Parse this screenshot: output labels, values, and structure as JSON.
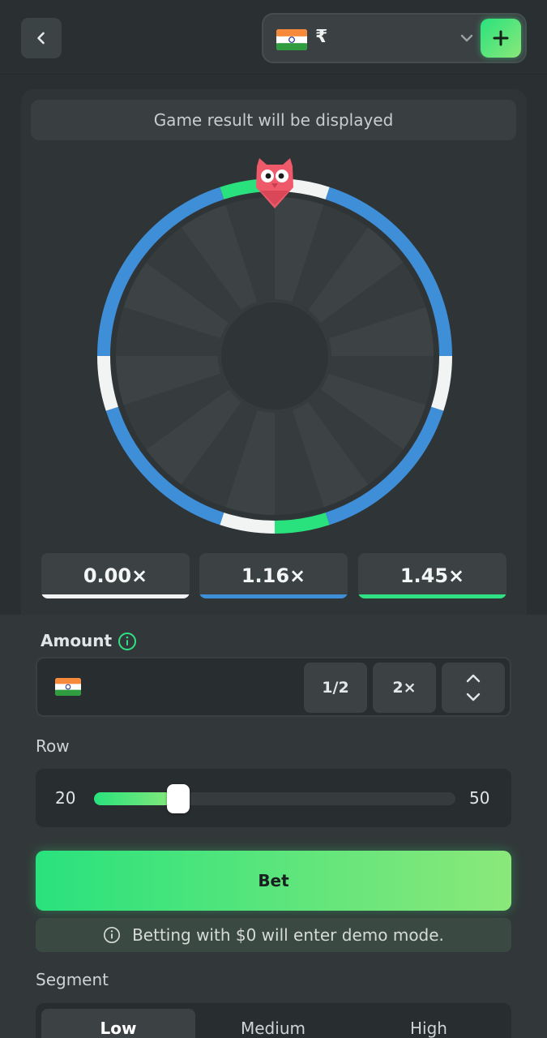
{
  "header": {
    "currency_symbol": "₹",
    "flag": "india-flag-icon"
  },
  "game": {
    "result_text": "Game result will be displayed",
    "multipliers": [
      {
        "label": "0.00×",
        "color": "#f2f4f4"
      },
      {
        "label": "1.16×",
        "color": "#3e8ed8"
      },
      {
        "label": "1.45×",
        "color": "#2fe184"
      }
    ]
  },
  "controls": {
    "amount_label": "Amount",
    "half_label": "1/2",
    "double_label": "2×",
    "row_label": "Row",
    "row_min": "20",
    "row_max": "50",
    "row_value": 27,
    "bet_label": "Bet",
    "demo_note": "Betting with $0 will enter demo mode.",
    "segment_label": "Segment",
    "segments": [
      "Low",
      "Medium",
      "High"
    ],
    "active_segment": "Low"
  },
  "colors": {
    "accent": "#29e27d",
    "blue": "#3e8ed8",
    "white": "#f2f4f4",
    "mascot": "#ef5a6a"
  }
}
